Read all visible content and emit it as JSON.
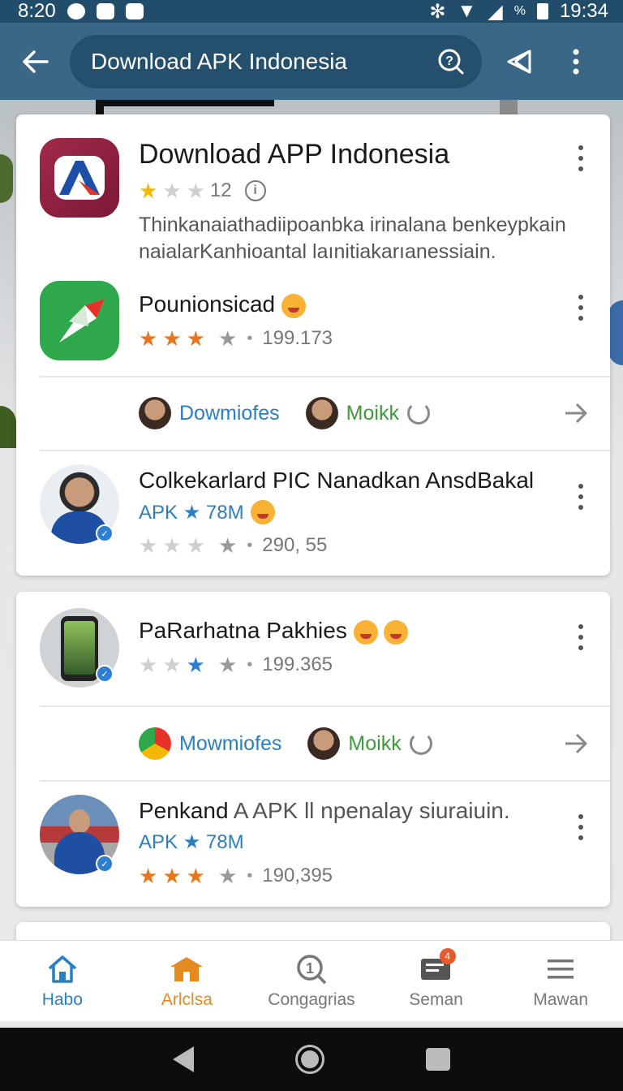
{
  "status_bar": {
    "time_left": "8:20",
    "time_right": "19:34",
    "battery_symbol": "%"
  },
  "app_bar": {
    "title": "Download APK Indonesia"
  },
  "card1": {
    "header": {
      "title": "Download APP Indonesia",
      "rating_count": "12",
      "description": "Thinkanaiathadiipoanbka irinalana benkeypkain naialarKanhioantal laınitiakarıanessiain."
    },
    "item1": {
      "title": "Pounionsicad",
      "rating_stars": 3,
      "downloads": "199.173"
    },
    "actions": {
      "chip1": "Dowmiofes",
      "chip2": "Moikk"
    },
    "item2": {
      "title": "Colkekarlard PIC Nanadkan AnsdBakal",
      "apk_label": "APK ★ 78M",
      "downloads": "290, 55"
    }
  },
  "card2": {
    "item1": {
      "title": "PaRarhatna Pakhies",
      "downloads": "199.365"
    },
    "actions": {
      "chip1": "Mowmiofes",
      "chip2": "Moikk"
    },
    "item2": {
      "title_bold": "Penkand",
      "title_rest": " A APK ll npenalay siuraiuin.",
      "apk_label": "APK ★ 78M",
      "downloads": "190,395"
    }
  },
  "bottom_nav": {
    "items": [
      {
        "label": "Habo",
        "icon": "home-icon"
      },
      {
        "label": "Arlclsa",
        "icon": "store-icon"
      },
      {
        "label": "Congagrias",
        "icon": "categories-icon"
      },
      {
        "label": "Seman",
        "icon": "messages-icon",
        "badge": "4"
      },
      {
        "label": "Mawan",
        "icon": "menu-icon"
      }
    ]
  },
  "colors": {
    "app_bar": "#3b6786",
    "accent_blue": "#2a7fc2",
    "accent_orange": "#e58a1f",
    "green": "#3f9a3c"
  }
}
